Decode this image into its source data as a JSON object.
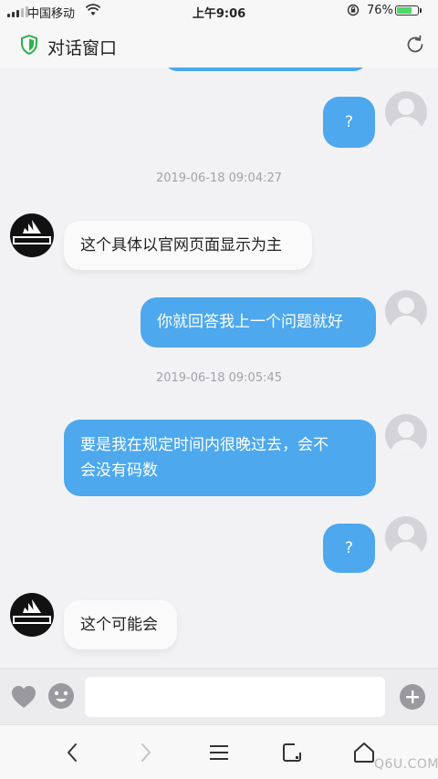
{
  "status_bar": {
    "carrier": "中国移动",
    "time": "上午9:06",
    "battery_percent": "76%",
    "battery_level": 0.76
  },
  "header": {
    "title": "对话窗口",
    "icons": [
      "shield-icon",
      "refresh-icon"
    ],
    "accent_color": "#2bb24c"
  },
  "chat": {
    "bubble_color": "#4da8ee",
    "messages": [
      {
        "type": "outgoing",
        "text": "?"
      },
      {
        "type": "timestamp",
        "text": "2019-06-18 09:04:27"
      },
      {
        "type": "incoming",
        "sender": "adidas",
        "text": "这个具体以官网页面显示为主"
      },
      {
        "type": "outgoing",
        "text": "你就回答我上一个问题就好"
      },
      {
        "type": "timestamp",
        "text": "2019-06-18 09:05:45"
      },
      {
        "type": "outgoing",
        "lines": [
          "要是我在规定时间内很晚过去，会不",
          "会没有码数"
        ]
      },
      {
        "type": "outgoing",
        "text": "?"
      },
      {
        "type": "incoming",
        "sender": "adidas",
        "text": "这个可能会"
      }
    ]
  },
  "input_bar": {
    "value": "",
    "placeholder": "",
    "icons": [
      "heart-icon",
      "emoji-icon",
      "plus-icon"
    ]
  },
  "browser_toolbar": {
    "icons": [
      "back-icon",
      "forward-icon",
      "menu-icon",
      "tabs-icon",
      "home-icon"
    ]
  },
  "watermark": "Q6U.COM"
}
